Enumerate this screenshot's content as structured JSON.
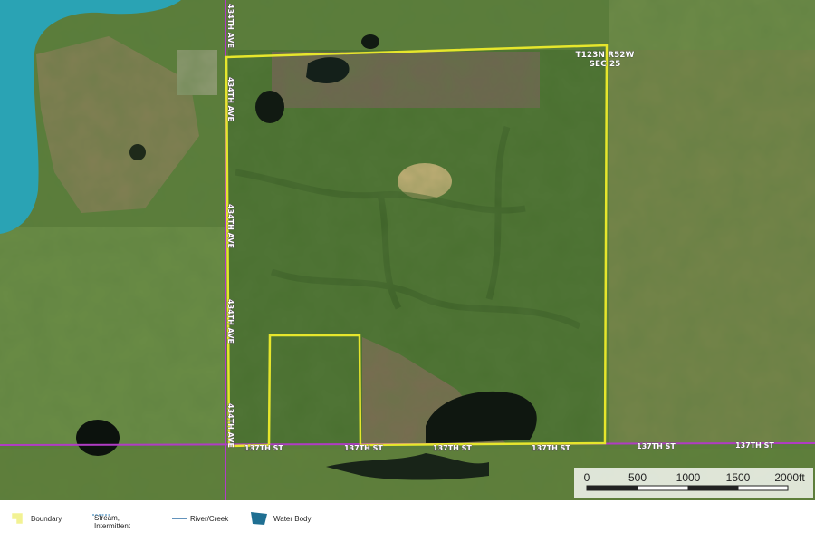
{
  "map": {
    "section_label_line1": "T123N R52W",
    "section_label_line2": "SEC 25",
    "roads": {
      "vertical": [
        "434TH AVE",
        "434TH AVE",
        "434TH AVE",
        "434TH AVE",
        "434TH AVE"
      ],
      "horizontal": [
        "137TH ST",
        "137TH ST",
        "137TH ST",
        "137TH ST",
        "137TH ST",
        "137TH ST"
      ]
    },
    "scale_bar": {
      "ticks": [
        "0",
        "500",
        "1000",
        "1500",
        "2000ft"
      ]
    },
    "colors": {
      "boundary": "#e6e62c",
      "road": "#b03cc4",
      "water": "#2aa3b4",
      "field_green": "#4f7a33",
      "field_tan": "#9a8a5c"
    }
  },
  "legend": {
    "items": [
      {
        "label": "Boundary",
        "icon": "boundary-icon"
      },
      {
        "label": "Stream,\nIntermittent",
        "icon": "stream-intermittent-icon"
      },
      {
        "label": "River/Creek",
        "icon": "river-creek-icon"
      },
      {
        "label": "Water Body",
        "icon": "water-body-icon"
      }
    ]
  }
}
